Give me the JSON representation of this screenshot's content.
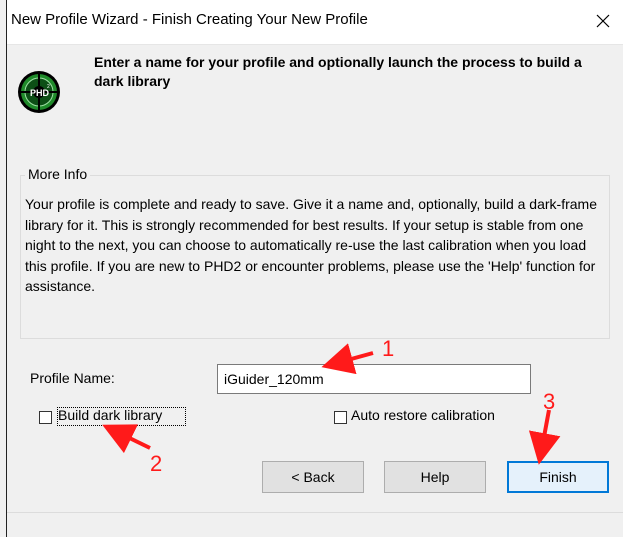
{
  "window": {
    "title": "New Profile Wizard - Finish Creating Your New Profile",
    "close_glyph": "×"
  },
  "logo": {
    "text": "PHD",
    "superscript": "2"
  },
  "heading": "Enter a name for your profile and optionally launch the process to build a dark library",
  "more_info": {
    "legend": "More Info",
    "text": "Your profile is complete and ready to save.  Give it a name and, optionally, build a dark-frame library for it. This is strongly recommended for best results. If your setup is stable from one night to the next, you can choose to automatically re-use the last calibration when you load this profile. If you are new to PHD2 or encounter problems, please use the 'Help' function for assistance."
  },
  "profile_name": {
    "label": "Profile Name:",
    "value": "iGuider_120mm"
  },
  "checkboxes": {
    "build_dark_library": {
      "label": "Build dark library",
      "checked": false
    },
    "auto_restore_calibration": {
      "label": "Auto restore calibration",
      "checked": false
    }
  },
  "buttons": {
    "back": "< Back",
    "help": "Help",
    "finish": "Finish"
  },
  "annotations": {
    "one": "1",
    "two": "2",
    "three": "3"
  },
  "colors": {
    "annotation": "#ff1a1a",
    "default_button_border": "#0078d7",
    "logo_green": "#1f8a2a"
  }
}
